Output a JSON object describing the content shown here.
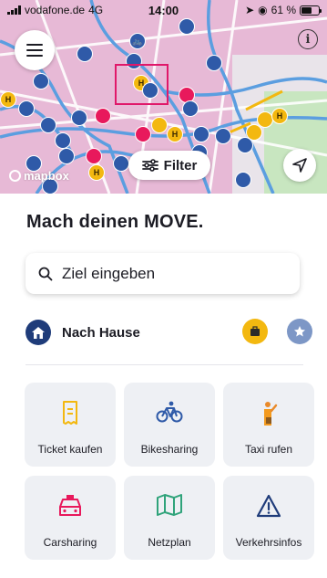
{
  "status_bar": {
    "carrier": "vodafone.de",
    "network": "4G",
    "time": "14:00",
    "battery": "61 %"
  },
  "map": {
    "attribution": "mapbox",
    "filter_label": "Filter",
    "base_color": "#e7b9d6",
    "street_color": "#5b9ee0",
    "pins": {
      "bike_color": "#2f5aa8",
      "tram_color": "#f3b810",
      "car_color": "#e8195c"
    },
    "highlight_color": "#e0186a"
  },
  "main": {
    "headline": "Mach deinen MOVE.",
    "search_placeholder": "Ziel eingeben",
    "home_label": "Nach Hause",
    "tiles": [
      {
        "label": "Ticket kaufen",
        "icon": "ticket-icon",
        "color": "#f3b810"
      },
      {
        "label": "Bikesharing",
        "icon": "bike-icon",
        "color": "#2f5aa8"
      },
      {
        "label": "Taxi rufen",
        "icon": "taxi-person-icon",
        "color": "#f39a1e"
      },
      {
        "label": "Carsharing",
        "icon": "car-icon",
        "color": "#e8195c"
      },
      {
        "label": "Netzplan",
        "icon": "map-icon",
        "color": "#2fa37a"
      },
      {
        "label": "Verkehrsinfos",
        "icon": "warning-icon",
        "color": "#1f3c7a"
      }
    ]
  }
}
